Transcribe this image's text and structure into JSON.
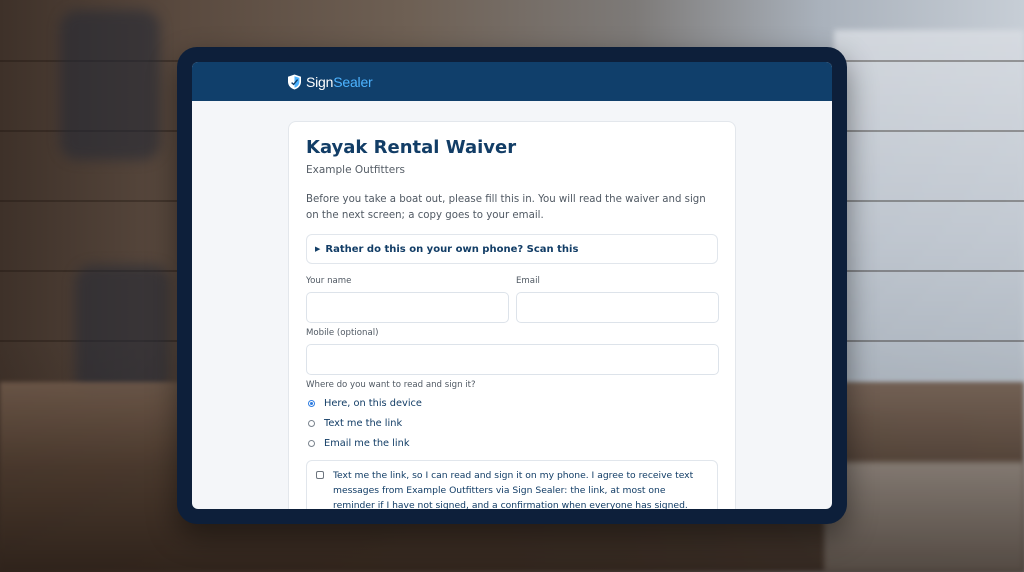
{
  "app": {
    "logo_name_part1": "Sign",
    "logo_name_part2": "Sealer",
    "header_color": "#103f6b",
    "accent_color": "#4db3ff"
  },
  "form": {
    "title": "Kayak Rental Waiver",
    "organization": "Example Outfitters",
    "intro": "Before you take a boat out, please fill this in. You will read the waiver and sign on the next screen; a copy goes to your email.",
    "qr_toggle_label": "Rather do this on your own phone? Scan this",
    "name_label": "Your name",
    "name_value": "",
    "email_label": "Email",
    "email_value": "",
    "mobile_label": "Mobile (optional)",
    "mobile_value": "",
    "sign_method_question": "Where do you want to read and sign it?",
    "sign_method_options": [
      {
        "label": "Here, on this device",
        "selected": true
      },
      {
        "label": "Text me the link",
        "selected": false
      },
      {
        "label": "Email me the link",
        "selected": false
      }
    ],
    "sms_consent_text": "Text me the link, so I can read and sign it on my phone. I agree to receive text messages from Example Outfitters via Sign Sealer: the link, at most one reminder if I have not signed, and a confirmation when everyone has signed. Message frequency"
  }
}
